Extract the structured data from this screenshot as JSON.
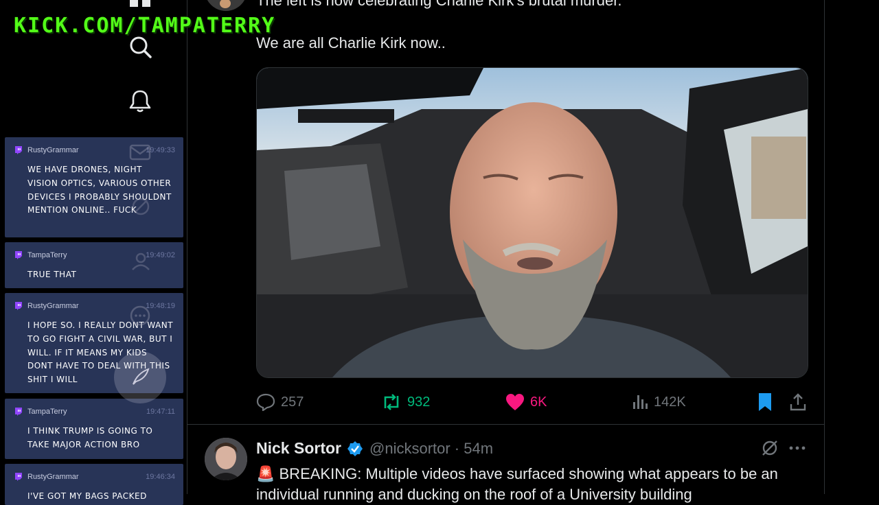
{
  "watermark": "KICK.COM/TAMPATERRY",
  "nav": {
    "icons": [
      "home-icon",
      "search-icon",
      "notifications-icon",
      "messages-icon",
      "grok-icon",
      "communities-icon",
      "profile-icon",
      "more-icon",
      "post-icon"
    ]
  },
  "chat": {
    "messages": [
      {
        "user": "RustyGrammar",
        "time": "19:49:33",
        "text": "WE HAVE DRONES, NIGHT VISION OPTICS, VARIOUS OTHER DEVICES I PROBABLY SHOULDNT MENTION ONLINE.. FUCK"
      },
      {
        "user": "TampaTerry",
        "time": "19:49:02",
        "text": "TRUE THAT"
      },
      {
        "user": "RustyGrammar",
        "time": "19:48:19",
        "text": "I HOPE SO. I REALLY DONT WANT TO GO FIGHT A CIVIL WAR, BUT I WILL. IF IT MEANS MY KIDS DONT HAVE TO DEAL WITH THIS SHIT I WILL"
      },
      {
        "user": "TampaTerry",
        "time": "19:47:11",
        "text": "I THINK TRUMP IS GOING TO TAKE MAJOR ACTION BRO"
      },
      {
        "user": "RustyGrammar",
        "time": "19:46:34",
        "text": "I'VE GOT MY BAGS PACKED"
      }
    ],
    "brand_color": "#9146ff"
  },
  "tweet1": {
    "line1": "The left is now celebrating Charlie Kirk's brutal murder.",
    "line2": "We are all Charlie Kirk now..",
    "replies": "257",
    "reposts": "932",
    "likes": "6K",
    "views": "142K",
    "colors": {
      "repost": "#00ba7c",
      "like": "#f91880",
      "bookmark": "#1d9bf0"
    }
  },
  "tweet2": {
    "name": "Nick Sortor",
    "handle": "@nicksortor · 54m",
    "text": "🚨 BREAKING: Multiple videos have surfaced showing what appears to be an individual running and ducking on the roof of a University building"
  }
}
